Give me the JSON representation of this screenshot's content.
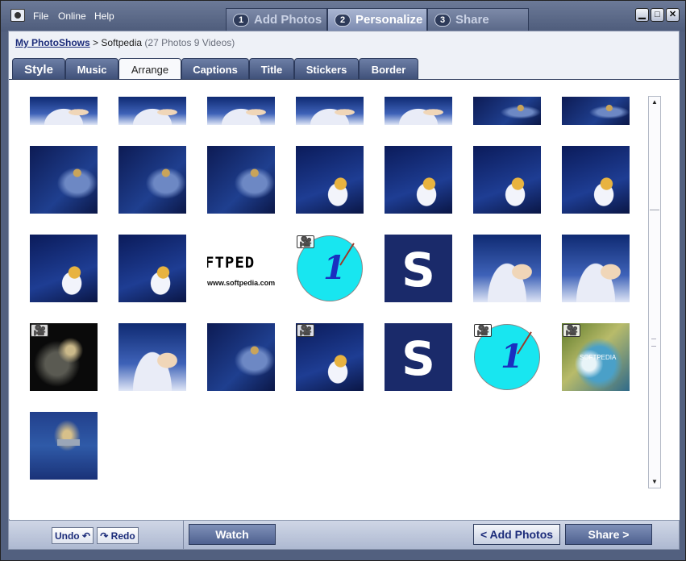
{
  "menu": {
    "file": "File",
    "online": "Online",
    "help": "Help"
  },
  "wizard": [
    {
      "num": "1",
      "label": "Add Photos"
    },
    {
      "num": "2",
      "label": "Personalize"
    },
    {
      "num": "3",
      "label": "Share"
    }
  ],
  "window_buttons": {
    "minimize": "▁",
    "maximize": "□",
    "close": "✕"
  },
  "breadcrumb": {
    "link": "My PhotoShows",
    "separator": " > ",
    "current": "Softpedia",
    "count": "(27 Photos 9 Videos)"
  },
  "tabs": [
    "Style",
    "Music",
    "Arrange",
    "Captions",
    "Title",
    "Stickers",
    "Border"
  ],
  "active_tab": "Arrange",
  "thumbnails": {
    "clock_digit": "1",
    "s_letter": "S",
    "text_big": "FTPED",
    "text_small": "www.softpedia.com",
    "green_label": "SOFTPEDIA",
    "video_icon": "🎥"
  },
  "scrollbar": {
    "up": "▲",
    "down": "▼"
  },
  "toolbar": {
    "undo": "Undo ↶",
    "redo": "↷ Redo",
    "watch": "Watch",
    "add_photos": "< Add Photos",
    "share": "Share >"
  }
}
